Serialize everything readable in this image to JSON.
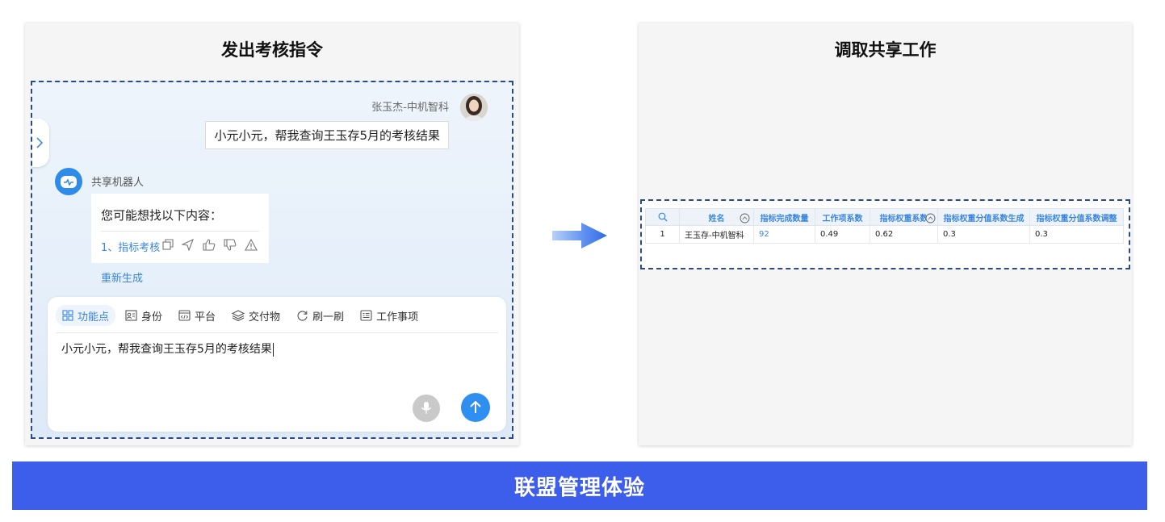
{
  "left_panel": {
    "title": "发出考核指令",
    "user": {
      "name": "张玉杰-中机智科",
      "message": "小元小元，帮我查询王玉存5月的考核结果"
    },
    "bot": {
      "name": "共享机器人",
      "intro": "您可能想找以下内容：",
      "suggestion": "1、指标考核",
      "regenerate": "重新生成"
    },
    "toolbar": [
      {
        "label": "功能点",
        "icon": "grid-icon",
        "active": true
      },
      {
        "label": "身份",
        "icon": "id-card-icon"
      },
      {
        "label": "平台",
        "icon": "code-window-icon"
      },
      {
        "label": "交付物",
        "icon": "layers-icon"
      },
      {
        "label": "刷一刷",
        "icon": "refresh-icon"
      },
      {
        "label": "工作事项",
        "icon": "list-icon"
      }
    ],
    "input_value": "小元小元，帮我查询王玉存5月的考核结果"
  },
  "right_panel": {
    "title": "调取共享工作",
    "table": {
      "headers": [
        "姓名",
        "指标完成数量",
        "工作项系数",
        "指标权重系数",
        "指标权重分值系数生成",
        "指标权重分值系数调整"
      ],
      "rows": [
        [
          "1",
          "王玉存-中机智科",
          "92",
          "0.49",
          "0.62",
          "0.3",
          "0.3"
        ]
      ]
    }
  },
  "banner": "联盟管理体验",
  "colors": {
    "accent": "#3a86e0",
    "banner": "#3d5deb",
    "send_button": "#2e8ff0",
    "dashed_border": "#2c4a86"
  }
}
